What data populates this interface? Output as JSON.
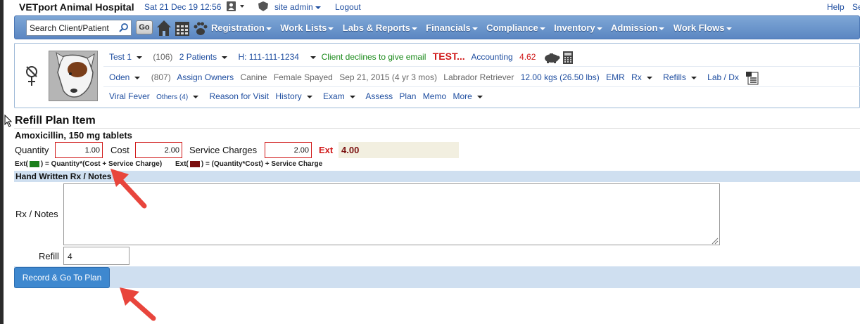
{
  "header": {
    "brand": "VETport Animal Hospital",
    "datetime": "Sat 21 Dec 19 12:56",
    "user": "site admin",
    "logout": "Logout",
    "help": "Help",
    "settings_partial": "Se"
  },
  "nav": {
    "search_placeholder": "Search Client/Patient",
    "go_label": "Go",
    "menu": [
      "Registration",
      "Work Lists",
      "Labs & Reports",
      "Financials",
      "Compliance",
      "Inventory",
      "Admission",
      "Work Flows"
    ]
  },
  "patient": {
    "row1": {
      "client": "Test 1",
      "client_count": "(106)",
      "patients": "2  Patients",
      "phone": "H: 111-111-1234",
      "email_note": "Client declines to give email",
      "alert": "TEST...",
      "accounting_label": "Accounting",
      "accounting_value": "4.62"
    },
    "row2": {
      "pet": "Oden",
      "pet_count": "(807)",
      "assign": "Assign Owners",
      "species": "Canine",
      "sex": "Female Spayed",
      "dob": "Sep 21, 2015 (4 yr 3 mos)",
      "breed": "Labrador Retriever",
      "weight": "12.00 kgs (26.50 lbs)",
      "emr": "EMR",
      "rx": "Rx",
      "refills": "Refills",
      "lab": "Lab / Dx"
    },
    "row3": {
      "problem": "Viral Fever",
      "others": "Others (4)",
      "reason": "Reason for Visit",
      "history": "History",
      "exam": "Exam",
      "assess": "Assess",
      "plan": "Plan",
      "memo": "Memo",
      "more": "More"
    }
  },
  "form": {
    "title": "Refill Plan Item",
    "drug": "Amoxicillin, 150 mg tablets",
    "quantity_label": "Quantity",
    "quantity": "1.00",
    "cost_label": "Cost",
    "cost": "2.00",
    "service_label": "Service Charges",
    "service": "2.00",
    "ext_label": "Ext",
    "ext_value": "4.00",
    "legend_green_prefix": "Ext(",
    "legend_green_suffix": ") = Quantity*(Cost + Service Charge)",
    "legend_red_prefix": "Ext(",
    "legend_red_suffix": ") = (Quantity*Cost) + Service Charge",
    "section_title": "Hand Written Rx / Notes",
    "notes_label": "Rx / Notes",
    "notes_value": "",
    "refill_label": "Refill",
    "refill_value": "4",
    "record_button": "Record & Go To Plan"
  },
  "colors": {
    "accent": "#5b86c2",
    "button": "#3e88cf",
    "alert_red": "#d01818",
    "legend_green": "#1a7f1a",
    "legend_red": "#7a0e0e",
    "arrow": "#e8453c"
  }
}
